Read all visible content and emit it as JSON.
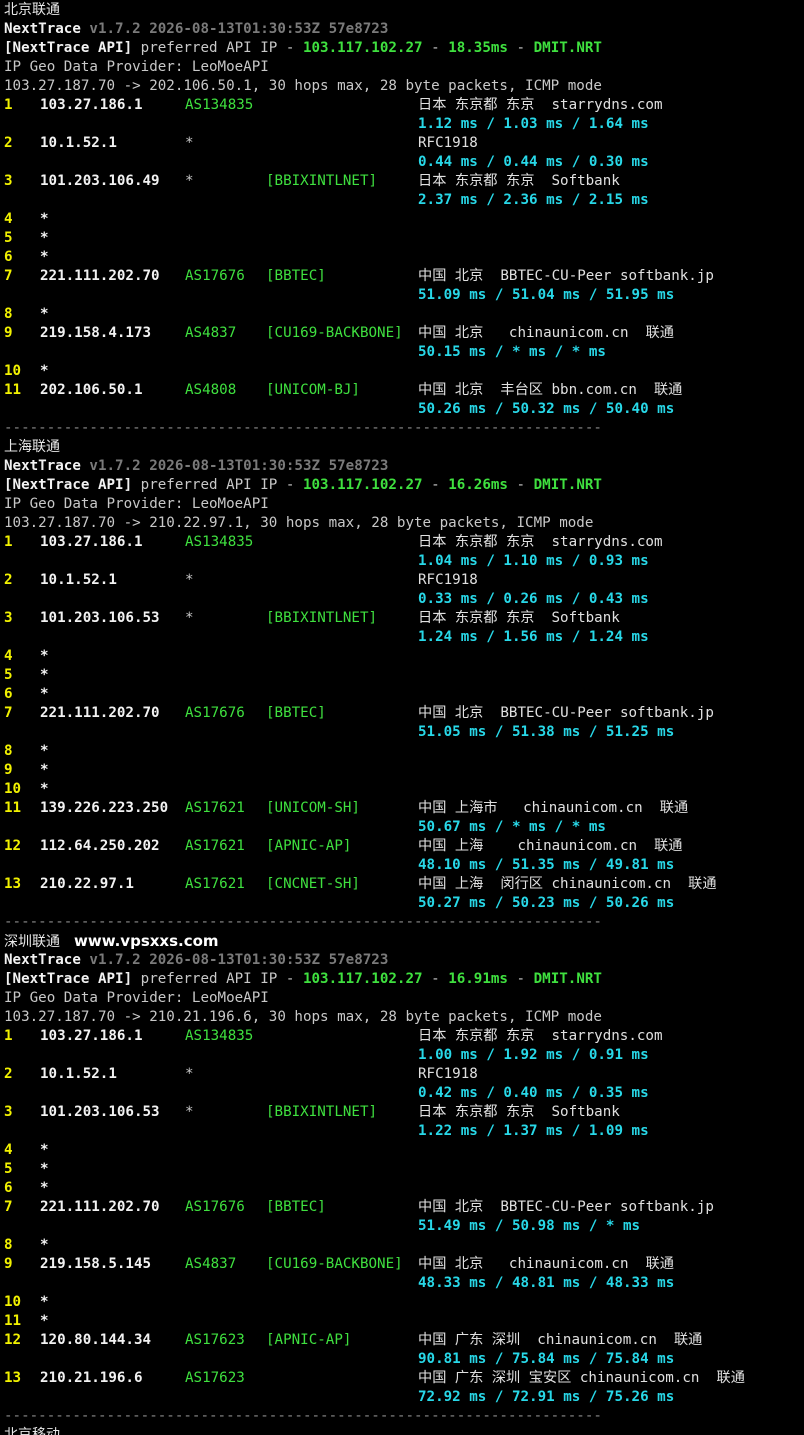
{
  "watermark": "www.vpsxxs.com",
  "blocks": [
    {
      "header": "北京联通",
      "show_watermark": false,
      "version": "v1.7.2 2026-08-13T01:30:53Z 57e8723",
      "api_ip": "103.117.102.27",
      "api_latency": "18.35ms",
      "api_node": "DMIT.NRT",
      "provider": "IP Geo Data Provider: LeoMoeAPI",
      "cmdline": "103.27.187.70 -> 202.106.50.1, 30 hops max, 28 byte packets, ICMP mode",
      "hops": [
        {
          "n": "1",
          "ip": "103.27.186.1",
          "as": "AS134835",
          "tag": "",
          "geo": "日本 东京都 东京  starrydns.com",
          "rtt": "1.12 ms / 1.03 ms / 1.64 ms"
        },
        {
          "n": "2",
          "ip": "10.1.52.1",
          "as": "*",
          "tag": "",
          "geo": "RFC1918",
          "rtt": "0.44 ms / 0.44 ms / 0.30 ms"
        },
        {
          "n": "3",
          "ip": "101.203.106.49",
          "as": "*",
          "tag": "[BBIXINTLNET]",
          "geo": "日本 东京都 东京  Softbank",
          "rtt": "2.37 ms / 2.36 ms / 2.15 ms"
        },
        {
          "n": "4",
          "ip": "*"
        },
        {
          "n": "5",
          "ip": "*"
        },
        {
          "n": "6",
          "ip": "*"
        },
        {
          "n": "7",
          "ip": "221.111.202.70",
          "as": "AS17676",
          "tag": "[BBTEC]",
          "geo": "中国 北京  BBTEC-CU-Peer softbank.jp",
          "rtt": "51.09 ms / 51.04 ms / 51.95 ms"
        },
        {
          "n": "8",
          "ip": "*"
        },
        {
          "n": "9",
          "ip": "219.158.4.173",
          "as": "AS4837",
          "tag": "[CU169-BACKBONE]",
          "geo": "中国 北京   chinaunicom.cn  联通",
          "rtt": "50.15 ms / * ms / * ms"
        },
        {
          "n": "10",
          "ip": "*"
        },
        {
          "n": "11",
          "ip": "202.106.50.1",
          "as": "AS4808",
          "tag": "[UNICOM-BJ]",
          "geo": "中国 北京  丰台区 bbn.com.cn  联通",
          "rtt": "50.26 ms / 50.32 ms / 50.40 ms"
        }
      ]
    },
    {
      "header": "上海联通",
      "show_watermark": false,
      "version": "v1.7.2 2026-08-13T01:30:53Z 57e8723",
      "api_ip": "103.117.102.27",
      "api_latency": "16.26ms",
      "api_node": "DMIT.NRT",
      "provider": "IP Geo Data Provider: LeoMoeAPI",
      "cmdline": "103.27.187.70 -> 210.22.97.1, 30 hops max, 28 byte packets, ICMP mode",
      "hops": [
        {
          "n": "1",
          "ip": "103.27.186.1",
          "as": "AS134835",
          "tag": "",
          "geo": "日本 东京都 东京  starrydns.com",
          "rtt": "1.04 ms / 1.10 ms / 0.93 ms"
        },
        {
          "n": "2",
          "ip": "10.1.52.1",
          "as": "*",
          "tag": "",
          "geo": "RFC1918",
          "rtt": "0.33 ms / 0.26 ms / 0.43 ms"
        },
        {
          "n": "3",
          "ip": "101.203.106.53",
          "as": "*",
          "tag": "[BBIXINTLNET]",
          "geo": "日本 东京都 东京  Softbank",
          "rtt": "1.24 ms / 1.56 ms / 1.24 ms"
        },
        {
          "n": "4",
          "ip": "*"
        },
        {
          "n": "5",
          "ip": "*"
        },
        {
          "n": "6",
          "ip": "*"
        },
        {
          "n": "7",
          "ip": "221.111.202.70",
          "as": "AS17676",
          "tag": "[BBTEC]",
          "geo": "中国 北京  BBTEC-CU-Peer softbank.jp",
          "rtt": "51.05 ms / 51.38 ms / 51.25 ms"
        },
        {
          "n": "8",
          "ip": "*"
        },
        {
          "n": "9",
          "ip": "*"
        },
        {
          "n": "10",
          "ip": "*"
        },
        {
          "n": "11",
          "ip": "139.226.223.250",
          "as": "AS17621",
          "tag": "[UNICOM-SH]",
          "geo": "中国 上海市   chinaunicom.cn  联通",
          "rtt": "50.67 ms / * ms / * ms"
        },
        {
          "n": "12",
          "ip": "112.64.250.202",
          "as": "AS17621",
          "tag": "[APNIC-AP]",
          "geo": "中国 上海    chinaunicom.cn  联通",
          "rtt": "48.10 ms / 51.35 ms / 49.81 ms"
        },
        {
          "n": "13",
          "ip": "210.22.97.1",
          "as": "AS17621",
          "tag": "[CNCNET-SH]",
          "geo": "中国 上海  闵行区 chinaunicom.cn  联通",
          "rtt": "50.27 ms / 50.23 ms / 50.26 ms"
        }
      ]
    },
    {
      "header": "深圳联通",
      "show_watermark": true,
      "version": "v1.7.2 2026-08-13T01:30:53Z 57e8723",
      "api_ip": "103.117.102.27",
      "api_latency": "16.91ms",
      "api_node": "DMIT.NRT",
      "provider": "IP Geo Data Provider: LeoMoeAPI",
      "cmdline": "103.27.187.70 -> 210.21.196.6, 30 hops max, 28 byte packets, ICMP mode",
      "hops": [
        {
          "n": "1",
          "ip": "103.27.186.1",
          "as": "AS134835",
          "tag": "",
          "geo": "日本 东京都 东京  starrydns.com",
          "rtt": "1.00 ms / 1.92 ms / 0.91 ms"
        },
        {
          "n": "2",
          "ip": "10.1.52.1",
          "as": "*",
          "tag": "",
          "geo": "RFC1918",
          "rtt": "0.42 ms / 0.40 ms / 0.35 ms"
        },
        {
          "n": "3",
          "ip": "101.203.106.53",
          "as": "*",
          "tag": "[BBIXINTLNET]",
          "geo": "日本 东京都 东京  Softbank",
          "rtt": "1.22 ms / 1.37 ms / 1.09 ms"
        },
        {
          "n": "4",
          "ip": "*"
        },
        {
          "n": "5",
          "ip": "*"
        },
        {
          "n": "6",
          "ip": "*"
        },
        {
          "n": "7",
          "ip": "221.111.202.70",
          "as": "AS17676",
          "tag": "[BBTEC]",
          "geo": "中国 北京  BBTEC-CU-Peer softbank.jp",
          "rtt": "51.49 ms / 50.98 ms / * ms"
        },
        {
          "n": "8",
          "ip": "*"
        },
        {
          "n": "9",
          "ip": "219.158.5.145",
          "as": "AS4837",
          "tag": "[CU169-BACKBONE]",
          "geo": "中国 北京   chinaunicom.cn  联通",
          "rtt": "48.33 ms / 48.81 ms / 48.33 ms"
        },
        {
          "n": "10",
          "ip": "*"
        },
        {
          "n": "11",
          "ip": "*"
        },
        {
          "n": "12",
          "ip": "120.80.144.34",
          "as": "AS17623",
          "tag": "[APNIC-AP]",
          "geo": "中国 广东 深圳  chinaunicom.cn  联通",
          "rtt": "90.81 ms / 75.84 ms / 75.84 ms"
        },
        {
          "n": "13",
          "ip": "210.21.196.6",
          "as": "AS17623",
          "tag": "",
          "geo": "中国 广东 深圳 宝安区 chinaunicom.cn  联通",
          "rtt": "72.92 ms / 72.91 ms / 75.26 ms"
        }
      ]
    }
  ],
  "next_header": "北京移动",
  "labels": {
    "tool": "NextTrace",
    "api": "[NextTrace API]",
    "api_text": " preferred API IP - ",
    "dash": " - "
  },
  "separator": "----------------------------------------------------------------------",
  "colors": {
    "background": "#000000",
    "text": "#d0d0d0",
    "green": "#3fe03f",
    "yellow": "#f2f200",
    "cyan": "#28d8e8",
    "gray": "#7a7a7a"
  }
}
